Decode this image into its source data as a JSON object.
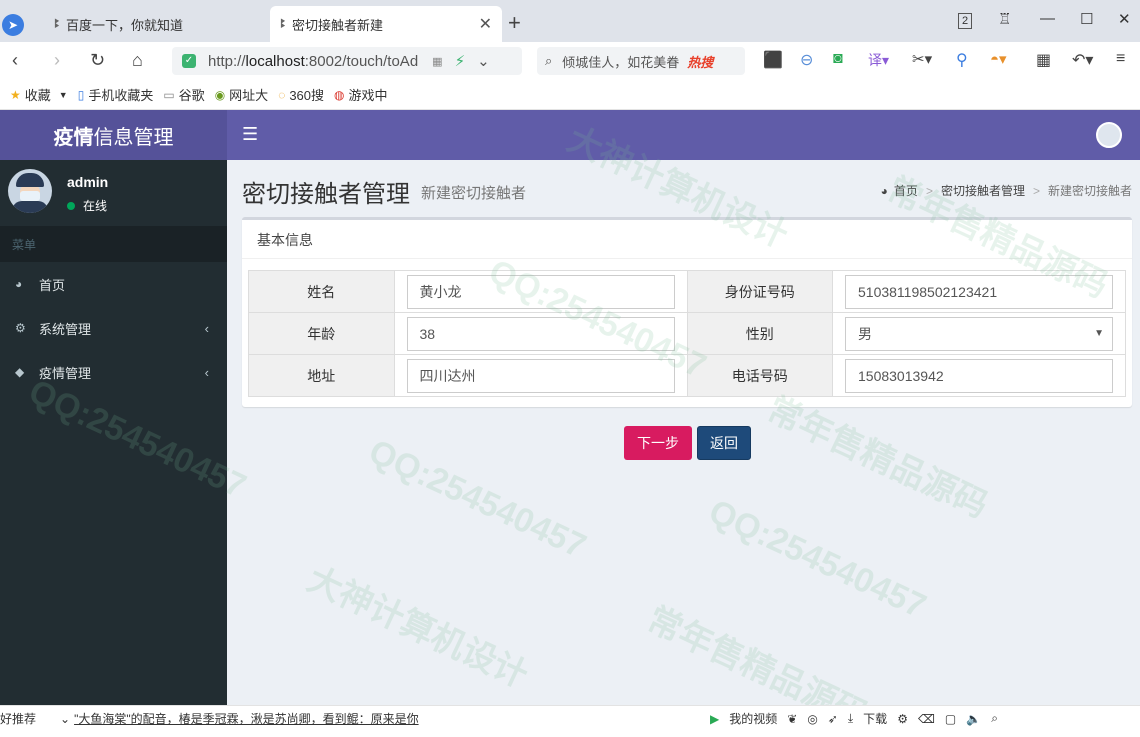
{
  "browser": {
    "tabs": [
      {
        "label": "百度一下，你就知道"
      },
      {
        "label": "密切接触者新建"
      }
    ],
    "url_prefix": "http://",
    "url_host": "localhost",
    "url_rest": ":8002/touch/toAd",
    "search_text": "倾城佳人，如花美眷",
    "search_hot": "热搜",
    "tab_count": "2",
    "bookmarks": [
      {
        "label": "收藏",
        "icon": "star-icon"
      },
      {
        "label": "手机收藏夹",
        "icon": "phone-icon"
      },
      {
        "label": "谷歌",
        "icon": "page-icon"
      },
      {
        "label": "网址大",
        "icon": "globe-icon"
      },
      {
        "label": "360搜",
        "icon": "search-icon"
      },
      {
        "label": "游戏中",
        "icon": "game-icon"
      }
    ]
  },
  "app": {
    "logo_bold": "疫情",
    "logo_rest": "信息管理",
    "user": {
      "name": "admin",
      "status": "在线"
    },
    "menu_header": "菜单",
    "menu": [
      {
        "label": "首页",
        "icon": "dashboard-icon"
      },
      {
        "label": "系统管理",
        "icon": "cogs-icon"
      },
      {
        "label": "疫情管理",
        "icon": "cube-icon"
      }
    ]
  },
  "page": {
    "title": "密切接触者管理",
    "subtitle": "新建密切接触者",
    "breadcrumb": [
      "首页",
      "密切接触者管理",
      "新建密切接触者"
    ],
    "box_title": "基本信息",
    "fields": {
      "name_label": "姓名",
      "name_value": "黄小龙",
      "idcard_label": "身份证号码",
      "idcard_value": "510381198502123421",
      "age_label": "年龄",
      "age_value": "38",
      "gender_label": "性别",
      "gender_value": "男",
      "address_label": "地址",
      "address_value": "四川达州",
      "phone_label": "电话号码",
      "phone_value": "15083013942"
    },
    "buttons": {
      "next": "下一步",
      "back": "返回"
    }
  },
  "statusbar": {
    "left": "好推荐",
    "news": "\"大鱼海棠\"的配音，椿是季冠霖，湫是苏尚卿，看到鲲：原来是你",
    "video": "我的视频",
    "download": "下载"
  },
  "watermarks": [
    "QQ:254540457",
    "大神计算机设计",
    "常年售精品源码"
  ],
  "colors": {
    "header": "#605ca8",
    "logo": "#555299",
    "sidebar": "#222d32",
    "next_btn": "#d81b60",
    "back_btn": "#1e4a7a"
  }
}
